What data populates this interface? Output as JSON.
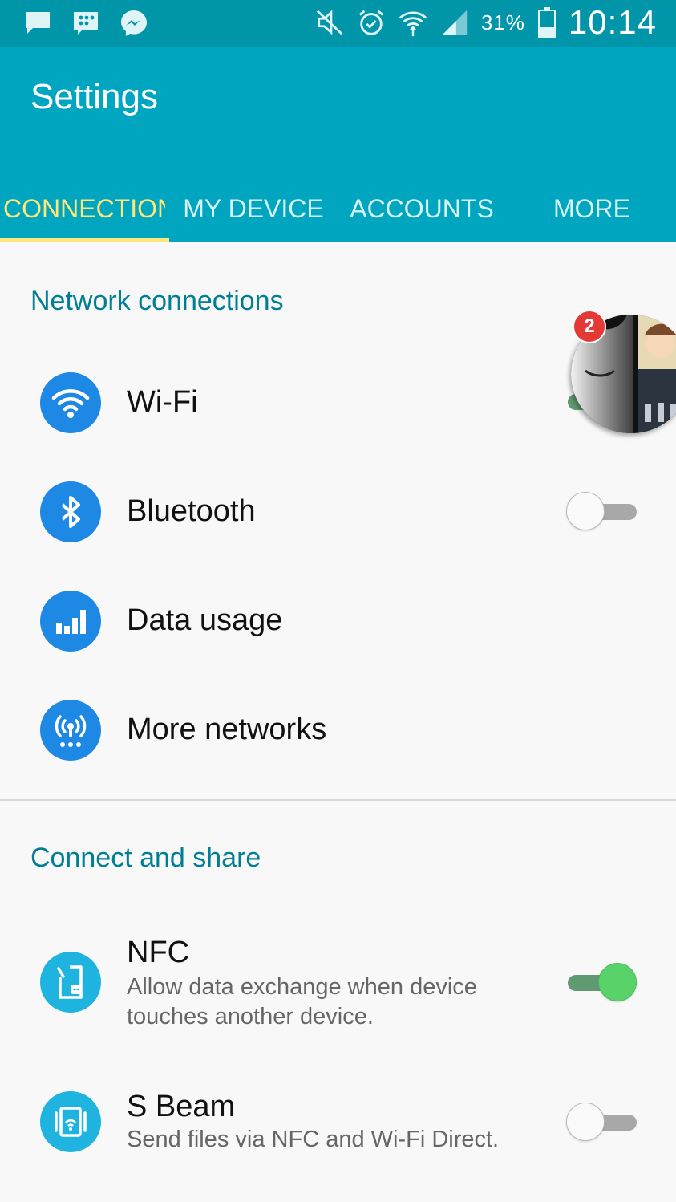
{
  "status_bar": {
    "battery_percent": "31%",
    "time": "10:14",
    "left_icons": [
      "message-icon",
      "bbm-icon",
      "messenger-icon"
    ],
    "right_icons": [
      "mute-icon",
      "alarm-icon",
      "wifi-icon",
      "signal-icon",
      "battery-icon"
    ]
  },
  "app_bar": {
    "title": "Settings",
    "tabs": [
      {
        "label": "CONNECTIONS",
        "active": true
      },
      {
        "label": "MY DEVICE",
        "active": false
      },
      {
        "label": "ACCOUNTS",
        "active": false
      },
      {
        "label": "MORE",
        "active": false
      }
    ]
  },
  "sections": [
    {
      "header": "Network connections",
      "items": [
        {
          "title": "Wi-Fi",
          "icon": "wifi-icon",
          "toggle": "on"
        },
        {
          "title": "Bluetooth",
          "icon": "bluetooth-icon",
          "toggle": "off"
        },
        {
          "title": "Data usage",
          "icon": "data-usage-icon"
        },
        {
          "title": "More networks",
          "icon": "more-networks-icon"
        }
      ]
    },
    {
      "header": "Connect and share",
      "items": [
        {
          "title": "NFC",
          "subtitle": "Allow data exchange when device touches another device.",
          "icon": "nfc-icon",
          "toggle": "on"
        },
        {
          "title": "S Beam",
          "subtitle": "Send files via NFC and Wi-Fi Direct.",
          "icon": "s-beam-icon",
          "toggle": "off"
        }
      ]
    }
  ],
  "chat_head": {
    "badge_count": "2"
  },
  "colors": {
    "status_bar": "#0095a8",
    "app_bar": "#00a5c0",
    "active_tab": "#ffe77a",
    "section_header": "#007e94",
    "icon_blue": "#1e88e5",
    "icon_cyan": "#1fb3e0",
    "toggle_on": "#5ad26a"
  }
}
